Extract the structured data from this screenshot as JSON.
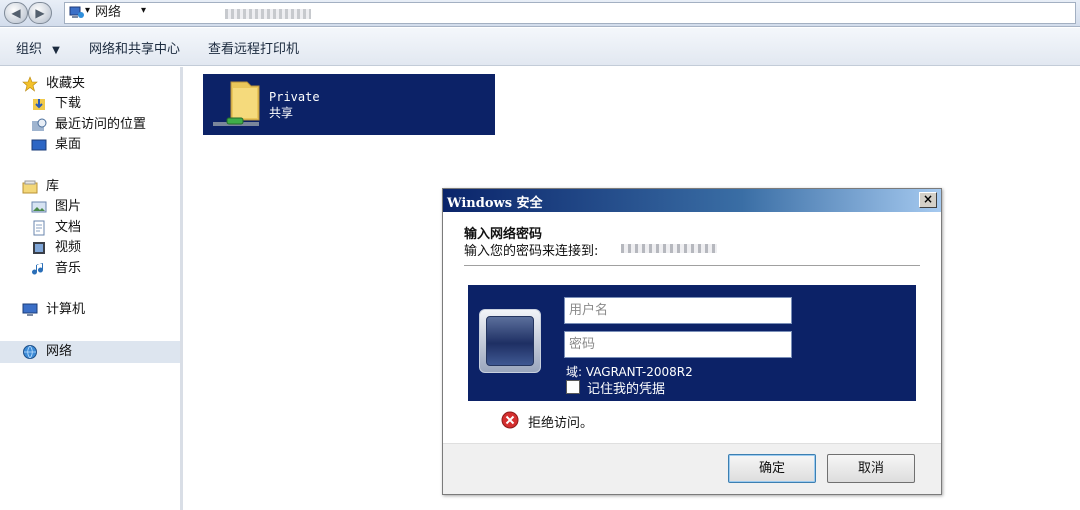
{
  "addressbar": {
    "path_root": "网络",
    "separator": "▾"
  },
  "toolbar": {
    "organize": "组织",
    "network_sharing_center": "网络和共享中心",
    "view_remote_printers": "查看远程打印机"
  },
  "navpane": {
    "favorites": {
      "label": "收藏夹",
      "items": [
        {
          "label": "下载",
          "icon": "downloads-icon"
        },
        {
          "label": "最近访问的位置",
          "icon": "recent-places-icon"
        },
        {
          "label": "桌面",
          "icon": "desktop-icon"
        }
      ]
    },
    "libraries": {
      "label": "库",
      "items": [
        {
          "label": "图片",
          "icon": "pictures-icon"
        },
        {
          "label": "文档",
          "icon": "documents-icon"
        },
        {
          "label": "视频",
          "icon": "videos-icon"
        },
        {
          "label": "音乐",
          "icon": "music-icon"
        }
      ]
    },
    "computer": "计算机",
    "network": "网络"
  },
  "content": {
    "share_name": "Private",
    "share_type": "共享"
  },
  "dialog": {
    "title": "Windows 安全",
    "close_glyph": "×",
    "heading": "输入网络密码",
    "subheading": "输入您的密码来连接到:",
    "username_placeholder": "用户名",
    "password_placeholder": "密码",
    "domain_text": "域: VAGRANT-2008R2",
    "remember_label": "记住我的凭据",
    "error_text": "拒绝访问。",
    "ok_label": "确定",
    "cancel_label": "取消"
  },
  "colors": {
    "selection_navy": "#0c2267",
    "title_gradient_start": "#0a246a",
    "error_red": "#d42f2f"
  }
}
